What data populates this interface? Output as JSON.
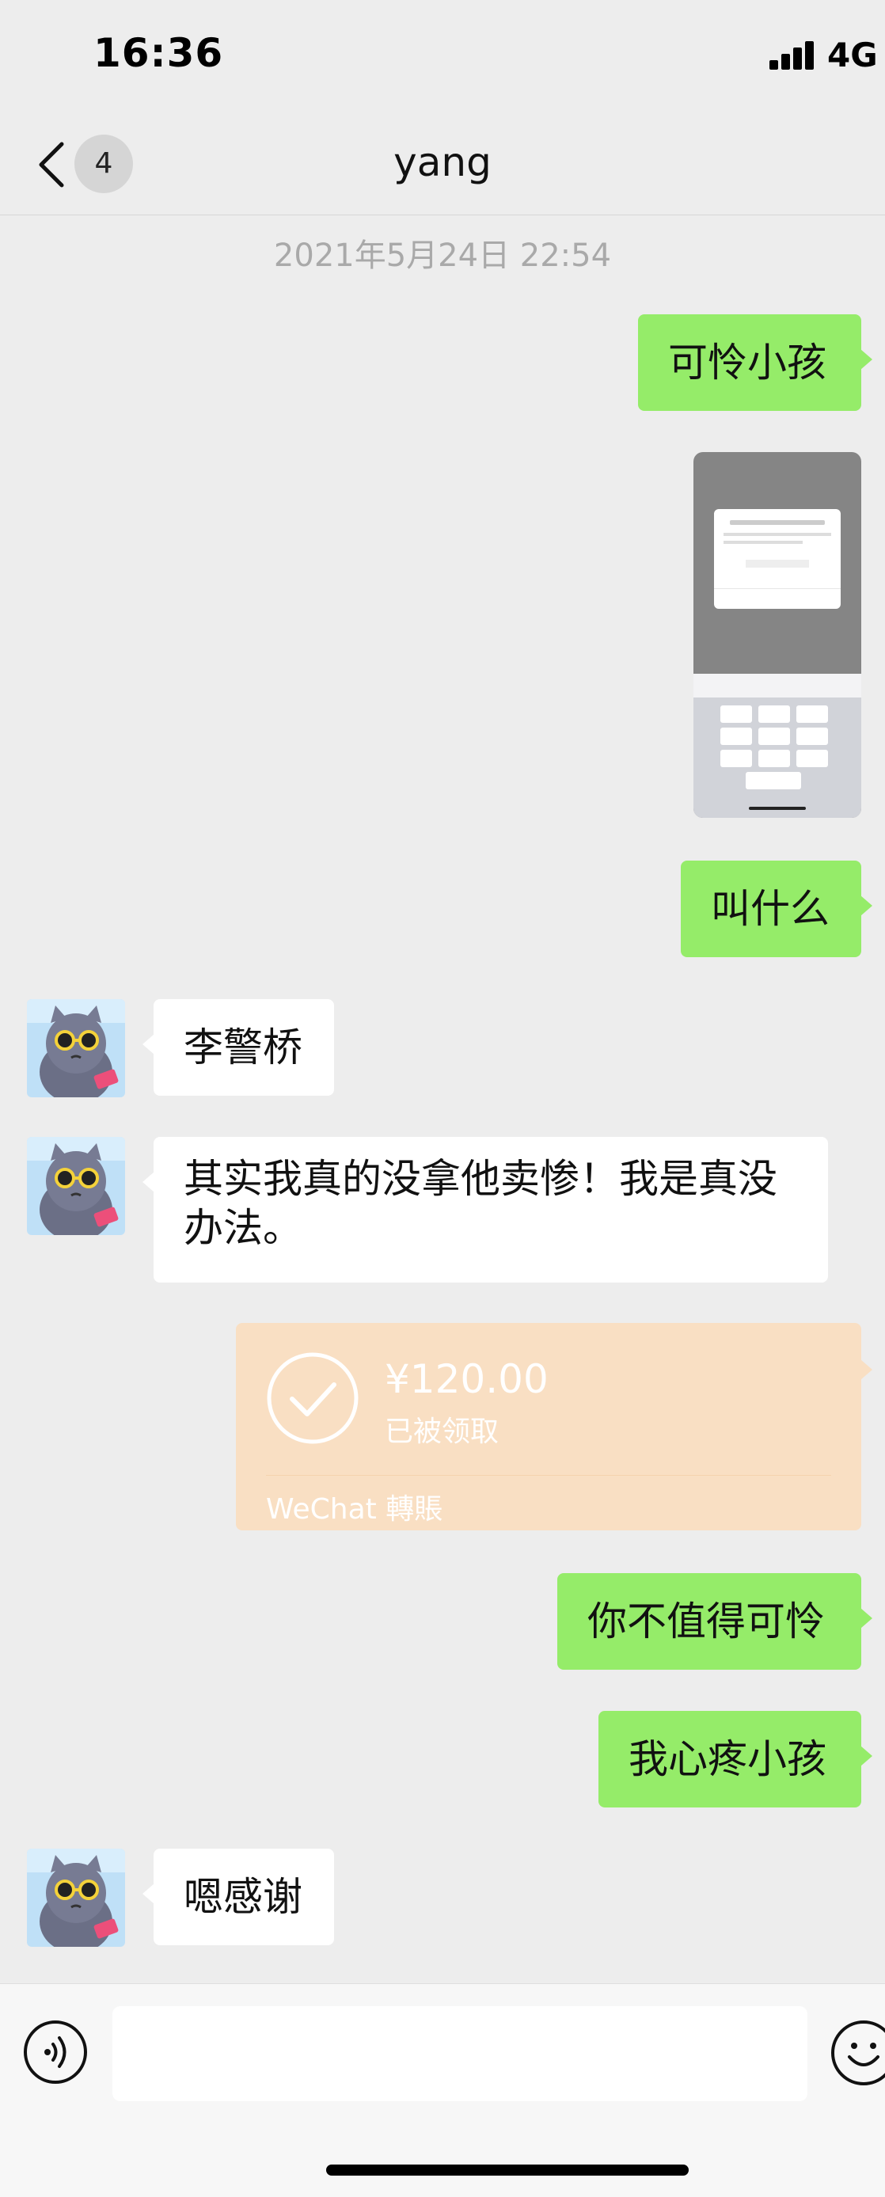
{
  "status_bar": {
    "time": "16:36",
    "network": "4G",
    "icons": [
      "signal-icon"
    ]
  },
  "nav": {
    "back_icon": "chevron-left-icon",
    "unread_count": "4",
    "title": "yang"
  },
  "messages": {
    "timestamp": "2021年5月24日 22:54",
    "m1": "可怜小孩",
    "m2_image": "screenshot-image",
    "m3": "叫什么",
    "m4": "李警桥",
    "m5": "其实我真的没拿他卖惨！我是真没办法。",
    "m6_transfer": {
      "amount": "¥120.00",
      "status": "已被领取",
      "brand": "WeChat 轉賬"
    },
    "m7": "你不值得可怜",
    "m8": "我心疼小孩",
    "m9": "嗯感谢"
  },
  "input_bar": {
    "value": "",
    "icons": [
      "voice-icon",
      "emoji-icon"
    ]
  },
  "colors": {
    "outgoing_bubble": "#95ec69",
    "incoming_bubble": "#ffffff",
    "transfer_card": "#f9dfc3",
    "background": "#ededed"
  }
}
